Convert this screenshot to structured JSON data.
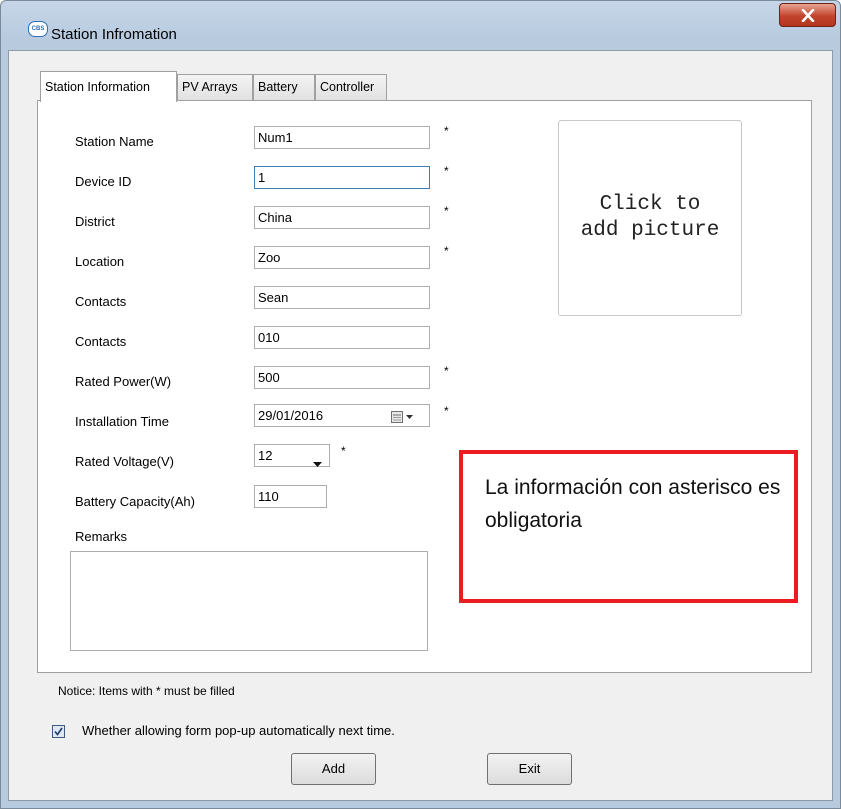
{
  "window": {
    "title": "Station Infromation",
    "icon": "app-logo-icon"
  },
  "tabs": [
    {
      "label": "Station Information",
      "active": true
    },
    {
      "label": "PV Arrays",
      "active": false
    },
    {
      "label": "Battery",
      "active": false
    },
    {
      "label": "Controller",
      "active": false
    }
  ],
  "form": {
    "station_name": {
      "label": "Station Name",
      "value": "Num1",
      "required": true
    },
    "device_id": {
      "label": "Device ID",
      "value": "1",
      "required": true
    },
    "district": {
      "label": "District",
      "value": "China",
      "required": true
    },
    "location": {
      "label": "Location",
      "value": "Zoo",
      "required": true
    },
    "contacts1": {
      "label": "Contacts",
      "value": "Sean",
      "required": false
    },
    "contacts2": {
      "label": "Contacts",
      "value": "010",
      "required": false
    },
    "rated_power": {
      "label": "Rated Power(W)",
      "value": "500",
      "required": true
    },
    "installation_time": {
      "label": "Installation Time",
      "value": "29/01/2016",
      "required": true
    },
    "rated_voltage": {
      "label": "Rated Voltage(V)",
      "value": "12",
      "required": true
    },
    "battery_capacity": {
      "label": "Battery Capacity(Ah)",
      "value": "110",
      "required": false
    },
    "remarks": {
      "label": "Remarks",
      "value": ""
    },
    "required_marker": "*"
  },
  "picture": {
    "placeholder": "Click to\nadd picture"
  },
  "annotation": {
    "text": "La información con asterisco es obligatoria",
    "border_color": "#ec1c24"
  },
  "notice": "Notice: Items with * must be filled",
  "popup_checkbox": {
    "label": "Whether allowing form pop-up automatically next time.",
    "checked": true
  },
  "buttons": {
    "add": "Add",
    "exit": "Exit"
  }
}
